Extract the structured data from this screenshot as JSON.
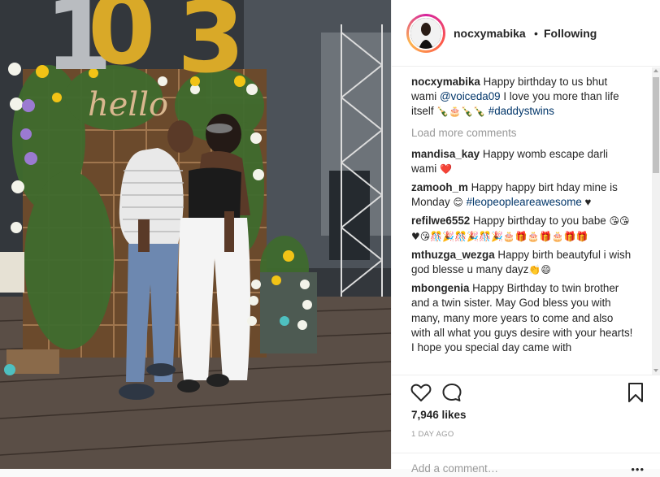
{
  "header": {
    "username": "nocxymabika",
    "separator": "•",
    "follow_state": "Following"
  },
  "caption": {
    "user": "nocxymabika",
    "text_before": " Happy birthday to us bhut wami ",
    "mention": "@voiceda09",
    "text_after": " I love you more than life itself ",
    "emojis": "🍾🎂🍾🍾",
    "hashtag": "#daddystwins"
  },
  "load_more": "Load more comments",
  "comments": [
    {
      "user": "mandisa_kay",
      "text": " Happy womb escape darli wami ",
      "emoji": "❤️"
    },
    {
      "user": "zamooh_m",
      "text": " Happy happy birt hday mine is Monday ",
      "emoji": "😊",
      "hashtag": "#leopeopleareawesome",
      "trail": " ♥"
    },
    {
      "user": "refilwe6552",
      "text": " Happy birthday to you babe ",
      "emoji": "😘😘♥😘🎊🎉🎊🎉🎊🎉🎂🎁🎂🎁🎂🎁🎁"
    },
    {
      "user": "mthuzga_wezga",
      "text": " Happy birth beautyful i wish god blesse u many dayz",
      "emoji": "👏😄"
    },
    {
      "user": "mbongenia",
      "text": " Happy Birthday to twin brother and a twin sister. May God bless you with many, many more years to come and also with all what you guys desire with your hearts! I hope you special day came with"
    }
  ],
  "likes": "7,946 likes",
  "date": "1 DAY AGO",
  "add_comment_placeholder": "Add a comment…",
  "more_label": "•••",
  "photo": {
    "balloon_digits": "03",
    "sign_text": "hello"
  },
  "colors": {
    "username": "#262626",
    "link": "#003569",
    "muted": "#999999",
    "heart_emoji": "#e0245e",
    "balloon_gold": "#d9a928",
    "balloon_silver": "#b9bcc0"
  },
  "icons": [
    "heart-icon",
    "comment-icon",
    "bookmark-icon"
  ]
}
